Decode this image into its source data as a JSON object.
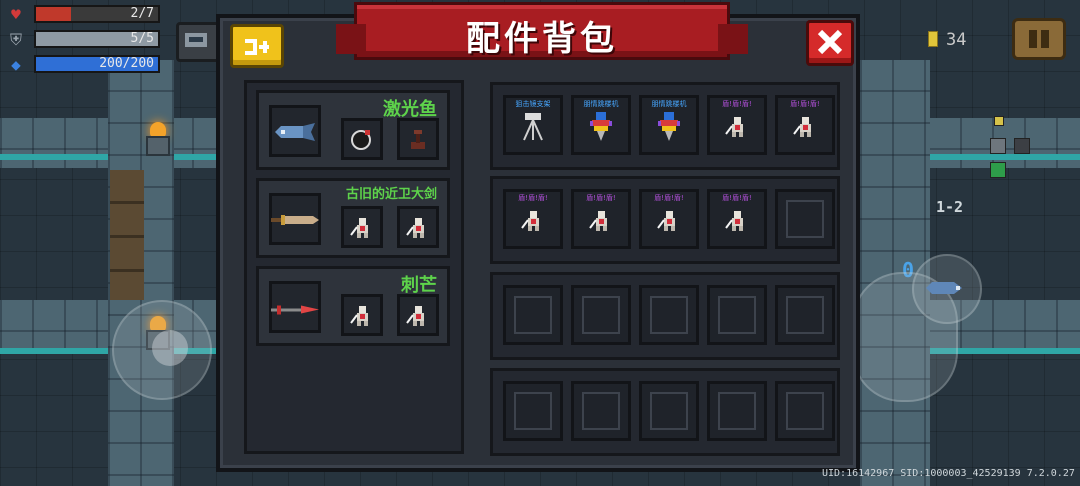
{
  "hud": {
    "health": {
      "text": "2/7",
      "current": 2,
      "max": 7,
      "color": "#c0392b"
    },
    "armor": {
      "text": "5/5",
      "current": 5,
      "max": 5,
      "color": "#8f9aa3"
    },
    "energy": {
      "text": "200/200",
      "current": 200,
      "max": 200,
      "color": "#2f6fd6"
    },
    "coins": "34",
    "level": "1-2",
    "zero_label": "0"
  },
  "dialog": {
    "title": "配件背包",
    "sort_icon": "sort-arrows-icon",
    "close_icon": "close-x-icon"
  },
  "weapons": [
    {
      "name": "激光鱼",
      "icon": "laser-fish-icon",
      "parts": [
        "bomb-icon",
        "turret-icon"
      ]
    },
    {
      "name": "古旧的近卫大剑",
      "icon": "old-guard-sword-icon",
      "parts": [
        "swordsman-icon",
        "swordsman-icon"
      ]
    },
    {
      "name": "刺芒",
      "icon": "thorn-spear-icon",
      "parts": [
        "swordsman-icon",
        "swordsman-icon"
      ]
    }
  ],
  "inventory": {
    "rows": [
      [
        {
          "label": "狙击镜支架",
          "icon": "tripod-icon",
          "label_color": "blue"
        },
        {
          "label": "朋情跳楼机",
          "icon": "jet-drill-icon",
          "label_color": "blue"
        },
        {
          "label": "朋情跳楼机",
          "icon": "jet-drill-icon",
          "label_color": "blue"
        },
        {
          "label": "盾!盾!盾!",
          "icon": "swordsman-icon",
          "label_color": "purple"
        },
        {
          "label": "盾!盾!盾!",
          "icon": "swordsman-icon",
          "label_color": "purple"
        }
      ],
      [
        {
          "label": "盾!盾!盾!",
          "icon": "swordsman-icon",
          "label_color": "purple"
        },
        {
          "label": "盾!盾!盾!",
          "icon": "swordsman-icon",
          "label_color": "purple"
        },
        {
          "label": "盾!盾!盾!",
          "icon": "swordsman-icon",
          "label_color": "purple"
        },
        {
          "label": "盾!盾!盾!",
          "icon": "swordsman-icon",
          "label_color": "purple"
        },
        {
          "label": "",
          "icon": "",
          "label_color": ""
        }
      ],
      [
        {
          "label": "",
          "icon": "",
          "label_color": ""
        },
        {
          "label": "",
          "icon": "",
          "label_color": ""
        },
        {
          "label": "",
          "icon": "",
          "label_color": ""
        },
        {
          "label": "",
          "icon": "",
          "label_color": ""
        },
        {
          "label": "",
          "icon": "",
          "label_color": ""
        }
      ],
      [
        {
          "label": "",
          "icon": "",
          "label_color": ""
        },
        {
          "label": "",
          "icon": "",
          "label_color": ""
        },
        {
          "label": "",
          "icon": "",
          "label_color": ""
        },
        {
          "label": "",
          "icon": "",
          "label_color": ""
        },
        {
          "label": "",
          "icon": "",
          "label_color": ""
        }
      ]
    ]
  },
  "footer": {
    "uid": "UID:16142967 SID:1000003_42529139 7.2.0.27"
  },
  "colors": {
    "panel": "#2b3038",
    "banner": "#a81d22",
    "weapon_name": "#5ed34b",
    "close_button": "#d52a2a",
    "sort_button": "#f0c21b"
  }
}
